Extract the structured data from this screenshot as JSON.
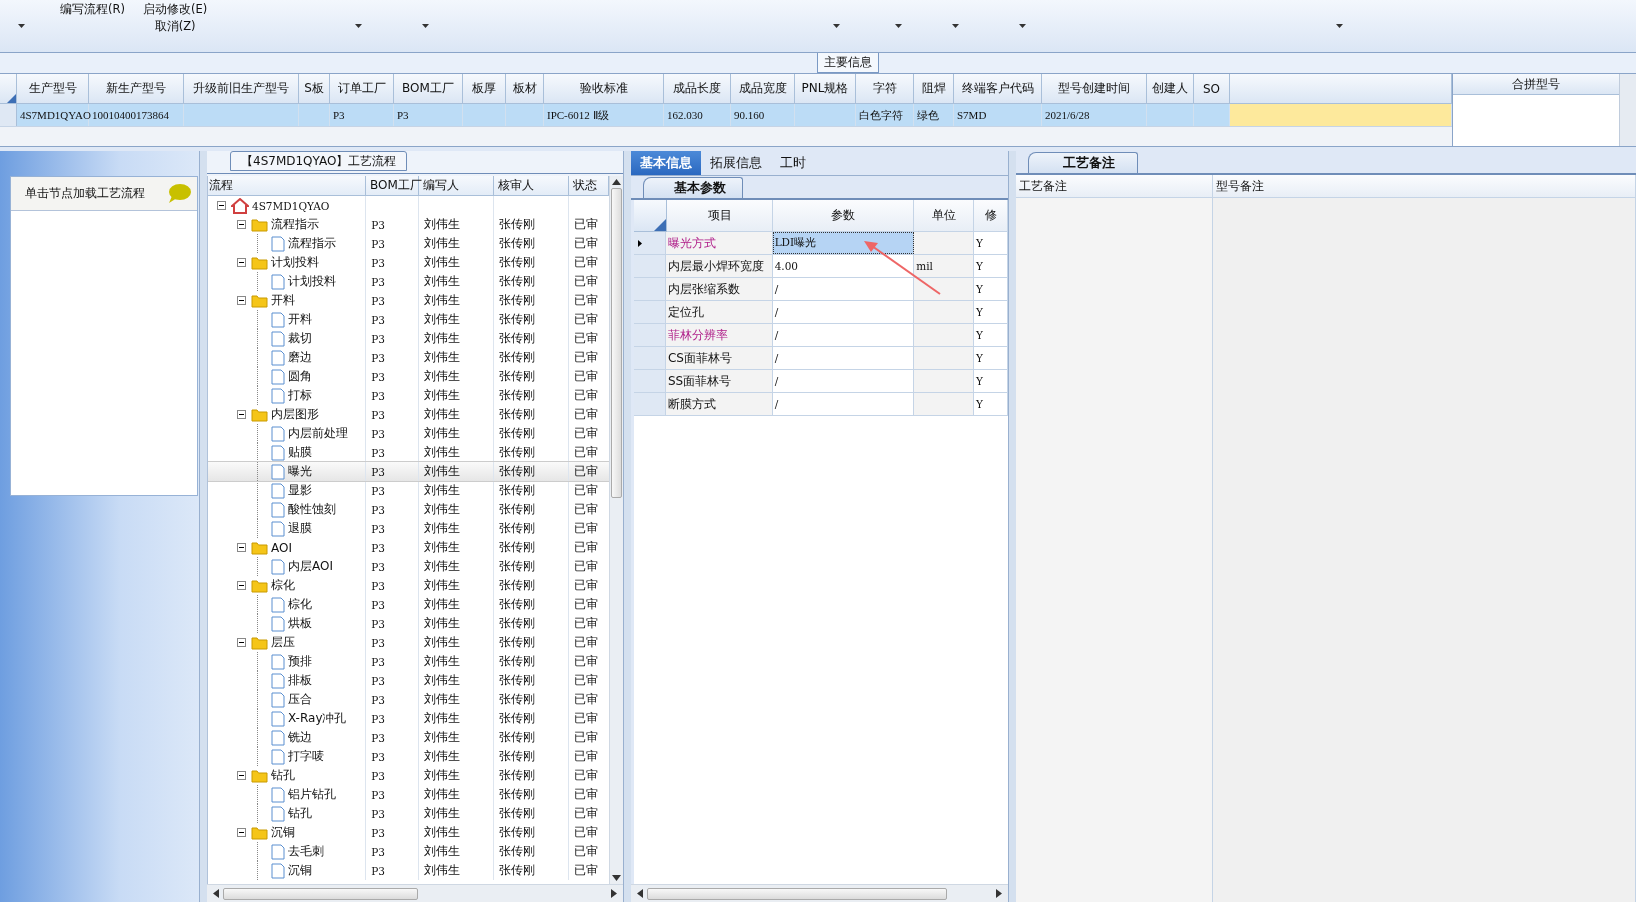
{
  "toolbar": {
    "buttons": [
      {
        "label": "编写流程(R)"
      },
      {
        "label": "启动修改(E)"
      },
      {
        "label": "取消(Z)"
      }
    ]
  },
  "main_info": {
    "title": "主要信息",
    "columns": [
      {
        "label": "生产型号",
        "value": "4S7MD1QYAO"
      },
      {
        "label": "新生产型号",
        "value": "10010400173864"
      },
      {
        "label": "升级前旧生产型号"
      },
      {
        "label": "S板"
      },
      {
        "label": "订单工厂",
        "value": "P3"
      },
      {
        "label": "BOM工厂",
        "value": "P3"
      },
      {
        "label": "板厚"
      },
      {
        "label": "板材"
      },
      {
        "label": "验收标准",
        "value": "IPC-6012 Ⅱ级"
      },
      {
        "label": "成品长度",
        "value": "162.030"
      },
      {
        "label": "成品宽度",
        "value": "90.160"
      },
      {
        "label": "PNL规格"
      },
      {
        "label": "字符",
        "value": "白色字符"
      },
      {
        "label": "阻焊",
        "value": "绿色"
      },
      {
        "label": "终端客户代码",
        "value": "S7MD"
      },
      {
        "label": "型号创建时间",
        "value": "2021/6/28"
      },
      {
        "label": "创建人"
      },
      {
        "label": "SO"
      }
    ],
    "row_selected": true,
    "side_column": "合拼型号"
  },
  "left_panel": {
    "hint": "单击节点加载工艺流程"
  },
  "process_tree": {
    "title": "【4S7MD1QYAO】工艺流程",
    "columns": [
      "流程",
      "BOM工厂",
      "编写人",
      "核审人",
      "状态"
    ],
    "root": {
      "label": "4S7MD1QYAO",
      "expanded": true,
      "selected": false,
      "children": [
        {
          "label": "流程指示",
          "bom": "P3",
          "writer": "刘伟生",
          "reviewer": "张传刚",
          "status": "已审",
          "expanded": true,
          "selected": false,
          "children": [
            {
              "label": "流程指示",
              "bom": "P3",
              "writer": "刘伟生",
              "reviewer": "张传刚",
              "status": "已审",
              "selected": false
            }
          ]
        },
        {
          "label": "计划投料",
          "bom": "P3",
          "writer": "刘伟生",
          "reviewer": "张传刚",
          "status": "已审",
          "expanded": true,
          "selected": false,
          "children": [
            {
              "label": "计划投料",
              "bom": "P3",
              "writer": "刘伟生",
              "reviewer": "张传刚",
              "status": "已审",
              "selected": false
            }
          ]
        },
        {
          "label": "开料",
          "bom": "P3",
          "writer": "刘伟生",
          "reviewer": "张传刚",
          "status": "已审",
          "expanded": true,
          "selected": false,
          "children": [
            {
              "label": "开料",
              "bom": "P3",
              "writer": "刘伟生",
              "reviewer": "张传刚",
              "status": "已审",
              "selected": false
            },
            {
              "label": "裁切",
              "bom": "P3",
              "writer": "刘伟生",
              "reviewer": "张传刚",
              "status": "已审",
              "selected": false
            },
            {
              "label": "磨边",
              "bom": "P3",
              "writer": "刘伟生",
              "reviewer": "张传刚",
              "status": "已审",
              "selected": false
            },
            {
              "label": "圆角",
              "bom": "P3",
              "writer": "刘伟生",
              "reviewer": "张传刚",
              "status": "已审",
              "selected": false
            },
            {
              "label": "打标",
              "bom": "P3",
              "writer": "刘伟生",
              "reviewer": "张传刚",
              "status": "已审",
              "selected": false
            }
          ]
        },
        {
          "label": "内层图形",
          "bom": "P3",
          "writer": "刘伟生",
          "reviewer": "张传刚",
          "status": "已审",
          "expanded": true,
          "selected": false,
          "children": [
            {
              "label": "内层前处理",
              "bom": "P3",
              "writer": "刘伟生",
              "reviewer": "张传刚",
              "status": "已审",
              "selected": false
            },
            {
              "label": "贴膜",
              "bom": "P3",
              "writer": "刘伟生",
              "reviewer": "张传刚",
              "status": "已审",
              "selected": false
            },
            {
              "label": "曝光",
              "bom": "P3",
              "writer": "刘伟生",
              "reviewer": "张传刚",
              "status": "已审",
              "selected": true
            },
            {
              "label": "显影",
              "bom": "P3",
              "writer": "刘伟生",
              "reviewer": "张传刚",
              "status": "已审",
              "selected": false
            },
            {
              "label": "酸性蚀刻",
              "bom": "P3",
              "writer": "刘伟生",
              "reviewer": "张传刚",
              "status": "已审",
              "selected": false
            },
            {
              "label": "退膜",
              "bom": "P3",
              "writer": "刘伟生",
              "reviewer": "张传刚",
              "status": "已审",
              "selected": false
            }
          ]
        },
        {
          "label": "AOI",
          "bom": "P3",
          "writer": "刘伟生",
          "reviewer": "张传刚",
          "status": "已审",
          "expanded": true,
          "selected": false,
          "children": [
            {
              "label": "内层AOI",
              "bom": "P3",
              "writer": "刘伟生",
              "reviewer": "张传刚",
              "status": "已审",
              "selected": false
            }
          ]
        },
        {
          "label": "棕化",
          "bom": "P3",
          "writer": "刘伟生",
          "reviewer": "张传刚",
          "status": "已审",
          "expanded": true,
          "selected": false,
          "children": [
            {
              "label": "棕化",
              "bom": "P3",
              "writer": "刘伟生",
              "reviewer": "张传刚",
              "status": "已审",
              "selected": false
            },
            {
              "label": "烘板",
              "bom": "P3",
              "writer": "刘伟生",
              "reviewer": "张传刚",
              "status": "已审",
              "selected": false
            }
          ]
        },
        {
          "label": "层压",
          "bom": "P3",
          "writer": "刘伟生",
          "reviewer": "张传刚",
          "status": "已审",
          "expanded": true,
          "selected": false,
          "children": [
            {
              "label": "预排",
              "bom": "P3",
              "writer": "刘伟生",
              "reviewer": "张传刚",
              "status": "已审",
              "selected": false
            },
            {
              "label": "排板",
              "bom": "P3",
              "writer": "刘伟生",
              "reviewer": "张传刚",
              "status": "已审",
              "selected": false
            },
            {
              "label": "压合",
              "bom": "P3",
              "writer": "刘伟生",
              "reviewer": "张传刚",
              "status": "已审",
              "selected": false
            },
            {
              "label": "X-Ray冲孔",
              "bom": "P3",
              "writer": "刘伟生",
              "reviewer": "张传刚",
              "status": "已审",
              "selected": false
            },
            {
              "label": "铣边",
              "bom": "P3",
              "writer": "刘伟生",
              "reviewer": "张传刚",
              "status": "已审",
              "selected": false
            },
            {
              "label": "打字唛",
              "bom": "P3",
              "writer": "刘伟生",
              "reviewer": "张传刚",
              "status": "已审",
              "selected": false
            }
          ]
        },
        {
          "label": "钻孔",
          "bom": "P3",
          "writer": "刘伟生",
          "reviewer": "张传刚",
          "status": "已审",
          "expanded": true,
          "selected": false,
          "children": [
            {
              "label": "铝片钻孔",
              "bom": "P3",
              "writer": "刘伟生",
              "reviewer": "张传刚",
              "status": "已审",
              "selected": false
            },
            {
              "label": "钻孔",
              "bom": "P3",
              "writer": "刘伟生",
              "reviewer": "张传刚",
              "status": "已审",
              "selected": false
            }
          ]
        },
        {
          "label": "沉铜",
          "bom": "P3",
          "writer": "刘伟生",
          "reviewer": "张传刚",
          "status": "已审",
          "expanded": true,
          "selected": false,
          "children": [
            {
              "label": "去毛刺",
              "bom": "P3",
              "writer": "刘伟生",
              "reviewer": "张传刚",
              "status": "已审",
              "selected": false
            },
            {
              "label": "沉铜",
              "bom": "P3",
              "writer": "刘伟生",
              "reviewer": "张传刚",
              "status": "已审",
              "selected": false
            }
          ]
        }
      ]
    }
  },
  "detail_tabs": [
    {
      "label": "基本信息",
      "selected": true
    },
    {
      "label": "拓展信息",
      "selected": false
    },
    {
      "label": "工时",
      "selected": false
    }
  ],
  "basic_params": {
    "title": "基本参数",
    "columns": [
      "项目",
      "参数",
      "单位",
      "修"
    ],
    "rows": [
      {
        "item": "曝光方式",
        "param": "LDI曝光",
        "flag": "Y",
        "emphasized": true,
        "selected": true
      },
      {
        "item": "内层最小焊环宽度",
        "param": "4.00",
        "unit": "mil",
        "flag": "Y",
        "emphasized": false,
        "selected": false
      },
      {
        "item": "内层张缩系数",
        "param": "/",
        "flag": "Y",
        "emphasized": false,
        "selected": false
      },
      {
        "item": "定位孔",
        "param": "/",
        "flag": "Y",
        "emphasized": false,
        "selected": false
      },
      {
        "item": "菲林分辨率",
        "param": "/",
        "flag": "Y",
        "emphasized": true,
        "selected": false
      },
      {
        "item": "CS面菲林号",
        "param": "/",
        "flag": "Y",
        "emphasized": false,
        "selected": false
      },
      {
        "item": "SS面菲林号",
        "param": "/",
        "flag": "Y",
        "emphasized": false,
        "selected": false
      },
      {
        "item": "断膜方式",
        "param": "/",
        "flag": "Y",
        "emphasized": false,
        "selected": false
      }
    ]
  },
  "remarks": {
    "title": "工艺备注",
    "columns": [
      "工艺备注",
      "型号备注"
    ]
  }
}
